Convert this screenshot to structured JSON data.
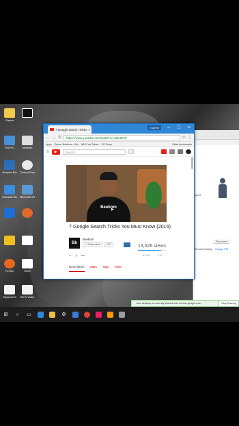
{
  "desktop": {
    "icons": [
      {
        "label": "Rayca"
      },
      {
        "label": "This PC"
      },
      {
        "label": "Network"
      },
      {
        "label": "Recycle Bin"
      },
      {
        "label": "Control Panel"
      },
      {
        "label": "Uninstall Sharing"
      },
      {
        "label": "Microsoft Edge"
      },
      {
        "label": "Firefox"
      },
      {
        "label": "WinX"
      },
      {
        "label": "Firefox 2"
      },
      {
        "label": "Equipment"
      },
      {
        "label": "WinX Video"
      }
    ]
  },
  "browser": {
    "tab_title": "7 Google Search Tricks",
    "signed_in": "Eugene",
    "url": "https://www.youtube.com/watch?v=ZEL2lmF",
    "bookmarks": [
      "Apps",
      "Prime: Beebom > Bu",
      "WHO as Tubes",
      "I/O Temp",
      "Other bookmarks"
    ]
  },
  "youtube": {
    "logo": "▶",
    "search_placeholder": "Search",
    "video": {
      "shirt_text": "Beebom",
      "title": "7 Google Search Tricks You Must Know (2016)",
      "channel": "Beebom",
      "avatar_text": "Bb",
      "subscribe_label": "✓ Subscribed",
      "subscriber_count": "27K",
      "views": "13,626 views",
      "view_bar_fraction": 0.83,
      "likes": "4 1.4K",
      "dislikes": "4 11"
    },
    "actions": [
      "+",
      "↗",
      "•••"
    ],
    "tabs": [
      "Description",
      "Stats",
      "Tags",
      "Tools"
    ]
  },
  "background_window": {
    "text1": "pport",
    "text2": "Disconnect",
    "text3": "Remote Desktop",
    "link": "Change PIN"
  },
  "notification": {
    "text": "Your desktop is currently shared with remote.google.com",
    "button": "Stop Sharing"
  },
  "taskbar": {
    "icons": [
      "start-icon",
      "search-icon",
      "task-view-icon",
      "edge-icon",
      "explorer-icon",
      "settings-icon",
      "store-icon",
      "chrome-icon",
      "app-icon",
      "app2-icon"
    ]
  },
  "colors": {
    "youtube_red": "#e62117",
    "chrome_blue": "#2f86d6",
    "taskbar": "#1e1e1e"
  }
}
